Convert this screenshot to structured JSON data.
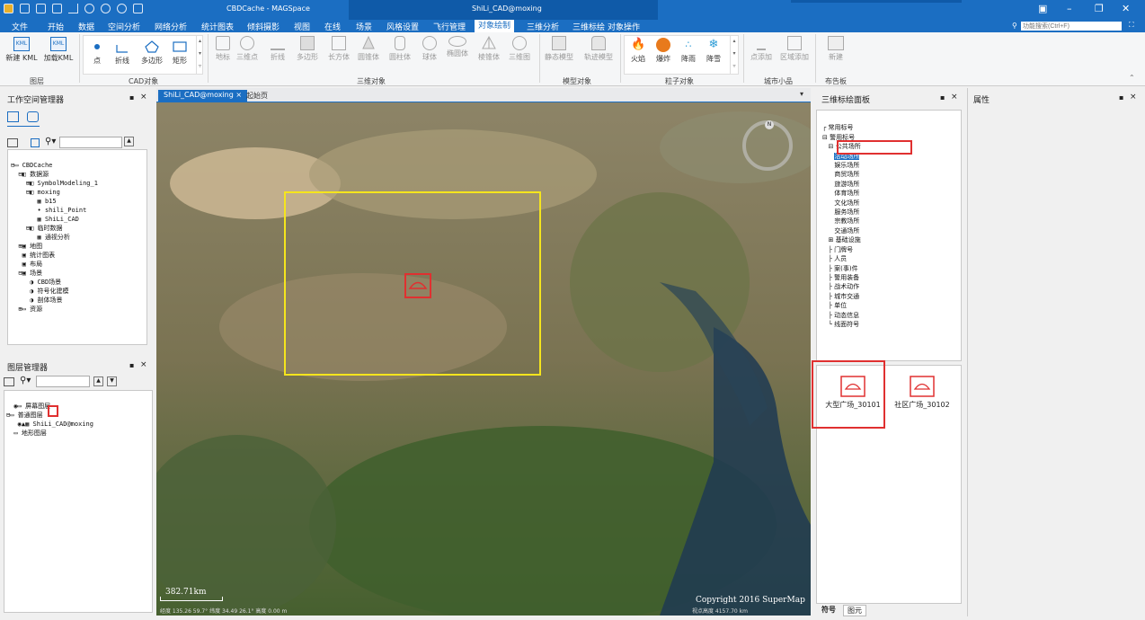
{
  "window": {
    "title_left": "CBDCache - MAGSpace",
    "title_active": "ShiLi_CAD@moxing"
  },
  "menu": {
    "items": [
      "文件",
      "开始",
      "数据",
      "空间分析",
      "网络分析",
      "统计图表",
      "倾斜摄影",
      "视图",
      "在线",
      "场景",
      "风格设置",
      "飞行管理",
      "对象绘制",
      "三维分析",
      "三维标绘",
      "对象操作"
    ],
    "active_index": 12,
    "search_placeholder": "功能搜索(Ctrl+F)"
  },
  "ribbon": {
    "kml": [
      "新建 KML",
      "加载KML"
    ],
    "cad": [
      "点",
      "折线",
      "多边形",
      "矩形"
    ],
    "obj3d": [
      "地标",
      "三维点",
      "折线",
      "多边形",
      "长方体",
      "圆锥体",
      "圆柱体",
      "球体",
      "椭圆体",
      "棱锥体",
      "三维图"
    ],
    "model": [
      "静态模型",
      "轨迹模型"
    ],
    "particle": [
      "火焰",
      "爆炸",
      "降雨",
      "降雪"
    ],
    "city": [
      "点添加",
      "区域添加"
    ],
    "board": [
      "新建"
    ],
    "groups": [
      "图层",
      "CAD对象",
      "三维对象",
      "模型对象",
      "粒子对象",
      "城市小品",
      "布告板"
    ]
  },
  "workspace": {
    "title": "工作空间管理器",
    "items": [
      "CBDCache",
      "数据源",
      "SymbolModeling_1",
      "moxing",
      "b15",
      "shili_Point",
      "ShiLi_CAD",
      "临时数据",
      "通视分析",
      "地图",
      "统计图表",
      "布局",
      "场景",
      "CBD场景",
      "符号化建模",
      "剖体场景",
      "资源"
    ]
  },
  "layers": {
    "title": "图层管理器",
    "items": [
      "屏幕图层",
      "普通图层",
      "ShiLi_CAD@moxing",
      "地形图层"
    ]
  },
  "doc_tabs": [
    "ShiLi_CAD@moxing",
    "起始页"
  ],
  "map": {
    "scale": "382.71km",
    "copyright": "Copyright 2016 SuperMap",
    "status_left": "经度 135.26 59.7° 纬度 34.49 26.1° 高度 0.00 m",
    "status_right": "视点高度 4157.70 km"
  },
  "plot_panel": {
    "title": "三维标绘面板",
    "tree": [
      "常用标号",
      "警用标号",
      "公共场所",
      "活动场所",
      "娱乐场所",
      "商贸场所",
      "旅游场所",
      "体育场所",
      "文化场所",
      "服务场所",
      "宗教场所",
      "交通场所",
      "基础设施",
      "门牌号",
      "人员",
      "案(事)件",
      "警用装备",
      "战术动作",
      "城市交通",
      "单位",
      "动态信息",
      "线面符号"
    ],
    "symbols": [
      "大型广场_30101",
      "社区广场_30102"
    ],
    "tabs": [
      "符号",
      "图元"
    ]
  },
  "props": {
    "title": "属性"
  }
}
